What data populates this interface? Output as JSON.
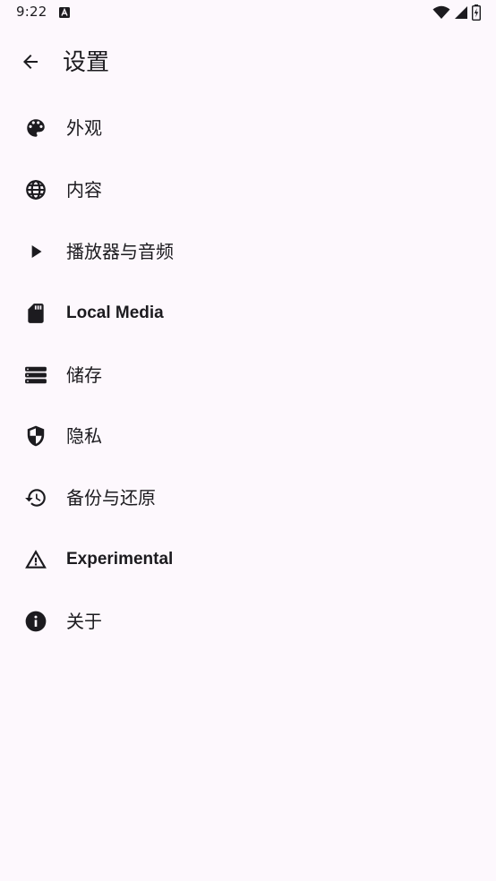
{
  "status_bar": {
    "time": "9:22",
    "notification_icon": "a-icon",
    "wifi_icon": "wifi-icon",
    "signal_icon": "signal-icon",
    "battery_icon": "battery-charging-icon"
  },
  "app_bar": {
    "back_icon": "arrow-back-icon",
    "title": "设置"
  },
  "settings": {
    "items": [
      {
        "label": "外观",
        "icon": "palette-icon"
      },
      {
        "label": "内容",
        "icon": "globe-icon"
      },
      {
        "label": "播放器与音频",
        "icon": "play-icon"
      },
      {
        "label": "Local Media",
        "icon": "sd-card-icon"
      },
      {
        "label": "储存",
        "icon": "storage-icon"
      },
      {
        "label": "隐私",
        "icon": "shield-icon"
      },
      {
        "label": "备份与还原",
        "icon": "history-icon"
      },
      {
        "label": "Experimental",
        "icon": "warning-icon"
      },
      {
        "label": "关于",
        "icon": "info-icon"
      }
    ]
  },
  "colors": {
    "background": "#fdf8fd",
    "text": "#1c1b1f",
    "icon": "#1c1b1f"
  }
}
